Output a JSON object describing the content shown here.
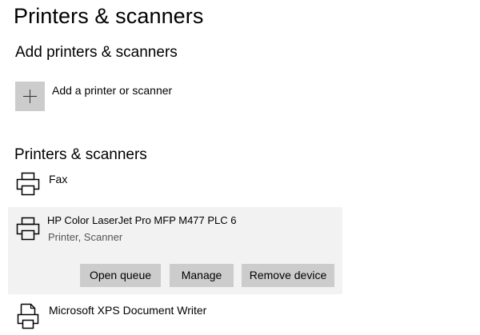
{
  "page": {
    "title": "Printers & scanners"
  },
  "add_section": {
    "title": "Add printers & scanners",
    "add_button_label": "Add a printer or scanner",
    "add_icon": "plus-icon"
  },
  "list_section": {
    "title": "Printers & scanners",
    "devices": [
      {
        "name": "Fax",
        "icon": "printer-icon"
      },
      {
        "name": "HP Color LaserJet Pro MFP M477 PLC 6",
        "subtitle": "Printer, Scanner",
        "icon": "printer-icon",
        "selected": true,
        "actions": {
          "open_queue": "Open queue",
          "manage": "Manage",
          "remove_device": "Remove device"
        }
      },
      {
        "name": "Microsoft XPS Document Writer",
        "icon": "document-printer-icon"
      }
    ]
  },
  "colors": {
    "selected_row_bg": "#f2f2f2",
    "button_bg": "#cccccc",
    "add_tile_bg": "#cccccc",
    "subtitle_text": "#555555"
  }
}
